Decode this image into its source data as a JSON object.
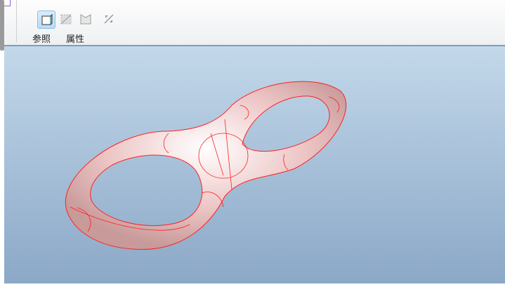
{
  "toolbar": {
    "tabs": [
      {
        "label": "参照"
      },
      {
        "label": "属性"
      }
    ],
    "icons": [
      "solid-surface-icon",
      "hatched-surface-icon",
      "open-surface-icon",
      "thicken-arrow-icon"
    ]
  },
  "colors": {
    "model_fill": "#e8bcbc",
    "edge": "#ff2020",
    "background_top": "#c3d8ea",
    "background_bottom": "#8ba8c7"
  }
}
